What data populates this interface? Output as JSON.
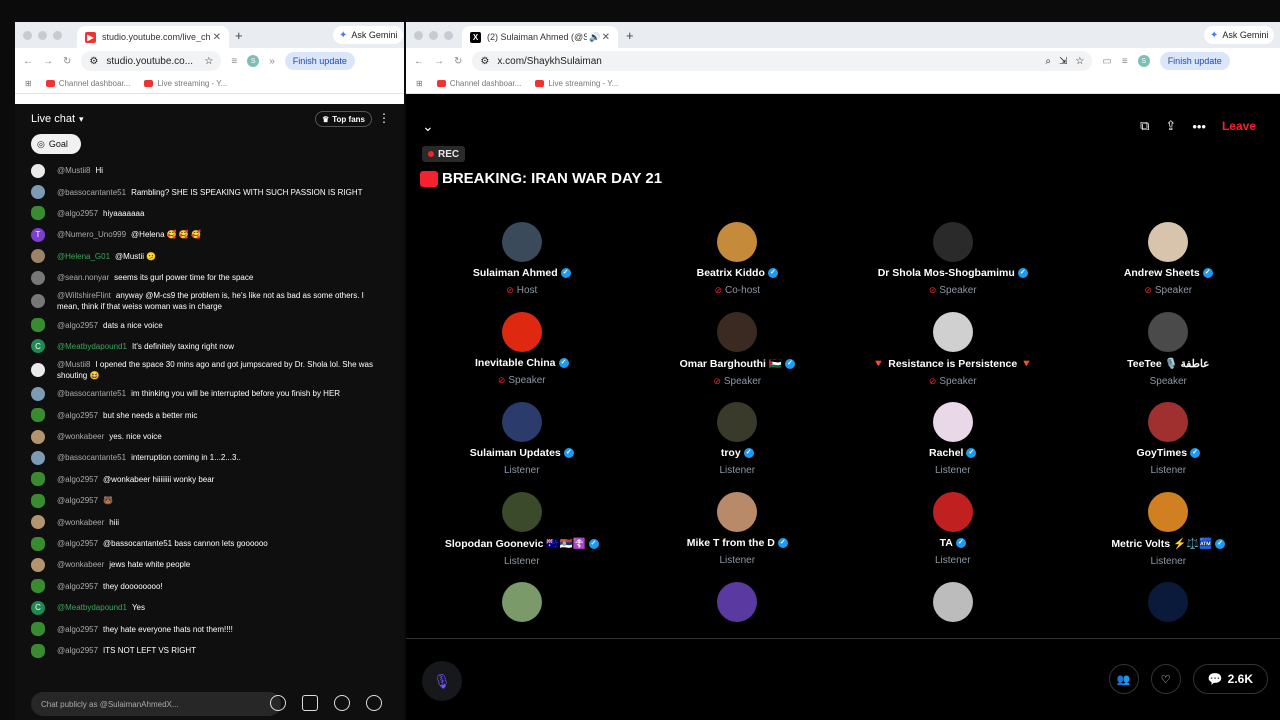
{
  "left_browser": {
    "tab_title": "studio.youtube.com/live_chat",
    "ask_gemini": "Ask Gemini",
    "url": "studio.youtube.co...",
    "finish_update": "Finish update",
    "profile_initial": "S",
    "bookmarks": [
      "Channel dashboar...",
      "Live streaming - Y..."
    ]
  },
  "live_chat": {
    "header": "Live chat",
    "top_fans": "Top fans",
    "goal": "Goal",
    "input_placeholder": "Chat publicly as @SulaimanAhmedX...",
    "messages": [
      {
        "author": "@Mustii8",
        "text": "Hi",
        "avatar": "white"
      },
      {
        "author": "@bassocantante51",
        "text": "Rambling? SHE IS SPEAKING WITH SUCH PASSION IS RIGHT",
        "avatar": "cloud"
      },
      {
        "author": "@algo2957",
        "text": "hiyaaaaaaa",
        "avatar": "frog"
      },
      {
        "author": "@Numero_Uno999",
        "text": "@Helena 🥰 🥰 🥰",
        "avatar": "t"
      },
      {
        "author": "@Helena_G01",
        "text": "@Mustii 🫤",
        "avatar": "tan",
        "green": true
      },
      {
        "author": "@sean.nonyar",
        "text": "seems its gurl power time for the space",
        "avatar": "gray"
      },
      {
        "author": "@WiltshireFlint",
        "text": "anyway @M-cs9 the problem is, he's like not as bad as some others. I mean, think if that weiss woman was in charge",
        "avatar": "gray"
      },
      {
        "author": "@algo2957",
        "text": "dats a nice voice",
        "avatar": "frog"
      },
      {
        "author": "@Meatbydapound1",
        "text": "It's definitely taxing right now",
        "avatar": "c",
        "green": true
      },
      {
        "author": "@Mustii8",
        "text": "I opened the space 30 mins ago and got jumpscared by Dr. Shola lol. She was shouting 😆",
        "avatar": "white"
      },
      {
        "author": "@bassocantante51",
        "text": "im thinking you will be interrupted before you finish by HER",
        "avatar": "cloud"
      },
      {
        "author": "@algo2957",
        "text": "but she needs a better mic",
        "avatar": "frog"
      },
      {
        "author": "@wonkabeer",
        "text": "yes. nice voice",
        "avatar": "cat"
      },
      {
        "author": "@bassocantante51",
        "text": "interruption coming in 1...2...3..",
        "avatar": "cloud"
      },
      {
        "author": "@algo2957",
        "text": "@wonkabeer hiiiiiiii wonky bear",
        "avatar": "frog"
      },
      {
        "author": "@algo2957",
        "text": "🐻",
        "avatar": "frog"
      },
      {
        "author": "@wonkabeer",
        "text": "hiii",
        "avatar": "cat"
      },
      {
        "author": "@algo2957",
        "text": "@bassocantante51 bass cannon lets goooooo",
        "avatar": "frog"
      },
      {
        "author": "@wonkabeer",
        "text": "jews hate white people",
        "avatar": "cat"
      },
      {
        "author": "@algo2957",
        "text": "they doooooooo!",
        "avatar": "frog"
      },
      {
        "author": "@Meatbydapound1",
        "text": "Yes",
        "avatar": "c",
        "green": true
      },
      {
        "author": "@algo2957",
        "text": "they hate everyone thats not them!!!!",
        "avatar": "frog"
      },
      {
        "author": "@algo2957",
        "text": "ITS NOT LEFT VS RIGHT",
        "avatar": "frog"
      }
    ]
  },
  "right_browser": {
    "tab_title": "(2) Sulaiman Ahmed (@S",
    "ask_gemini": "Ask Gemini",
    "url": "x.com/ShaykhSulaiman",
    "finish_update": "Finish update",
    "profile_initial": "S",
    "bookmarks": [
      "Channel dashboar...",
      "Live streaming - Y..."
    ]
  },
  "space": {
    "leave": "Leave",
    "rec": "REC",
    "title": "BREAKING: IRAN WAR DAY 21",
    "listener_count": "2.6K",
    "participants": [
      {
        "name": "Sulaiman Ahmed",
        "role": "Host",
        "muted": true,
        "verified": true,
        "color": "#3b4a5a"
      },
      {
        "name": "Beatrix Kiddo",
        "role": "Co-host",
        "muted": true,
        "verified": true,
        "color": "#c58a3a"
      },
      {
        "name": "Dr Shola Mos-Shogbamimu",
        "role": "Speaker",
        "muted": true,
        "verified": true,
        "color": "#2a2a2a"
      },
      {
        "name": "Andrew Sheets",
        "role": "Speaker",
        "muted": true,
        "verified": true,
        "color": "#d8c4ad"
      },
      {
        "name": "Inevitable China",
        "role": "Speaker",
        "muted": true,
        "verified": true,
        "color": "#de2910"
      },
      {
        "name": "Omar Barghouthi 🇵🇸",
        "role": "Speaker",
        "muted": true,
        "verified": true,
        "color": "#3a2a22"
      },
      {
        "name": "🔻 Resistance is Persistence 🔻",
        "role": "Speaker",
        "muted": true,
        "verified": false,
        "color": "#d0d0d0"
      },
      {
        "name": "TeeTee 🎙️ عاطفة",
        "role": "Speaker",
        "muted": false,
        "verified": false,
        "color": "#4a4a4a"
      },
      {
        "name": "Sulaiman Updates",
        "role": "Listener",
        "muted": false,
        "verified": true,
        "color": "#2b3b6b"
      },
      {
        "name": "troy",
        "role": "Listener",
        "muted": false,
        "verified": true,
        "color": "#3a3a2a"
      },
      {
        "name": "Rachel",
        "role": "Listener",
        "muted": false,
        "verified": true,
        "color": "#e8d8e8"
      },
      {
        "name": "GoyTimes",
        "role": "Listener",
        "muted": false,
        "verified": true,
        "color": "#a03030"
      },
      {
        "name": "Slopodan Goonevic 🇦🇺🇷🇸☦️",
        "role": "Listener",
        "muted": false,
        "verified": true,
        "color": "#3a4a2a"
      },
      {
        "name": "Mike T from the D",
        "role": "Listener",
        "muted": false,
        "verified": true,
        "color": "#b88a6a"
      },
      {
        "name": "TA",
        "role": "Listener",
        "muted": false,
        "verified": true,
        "color": "#c02020"
      },
      {
        "name": "Metric Volts ⚡⚖️🏧",
        "role": "Listener",
        "muted": false,
        "verified": true,
        "color": "#d08020"
      }
    ],
    "partial_avatars": [
      "#7a9a6a",
      "#5a3aa0",
      "#bcbcbc",
      "#0a1a3a"
    ]
  }
}
